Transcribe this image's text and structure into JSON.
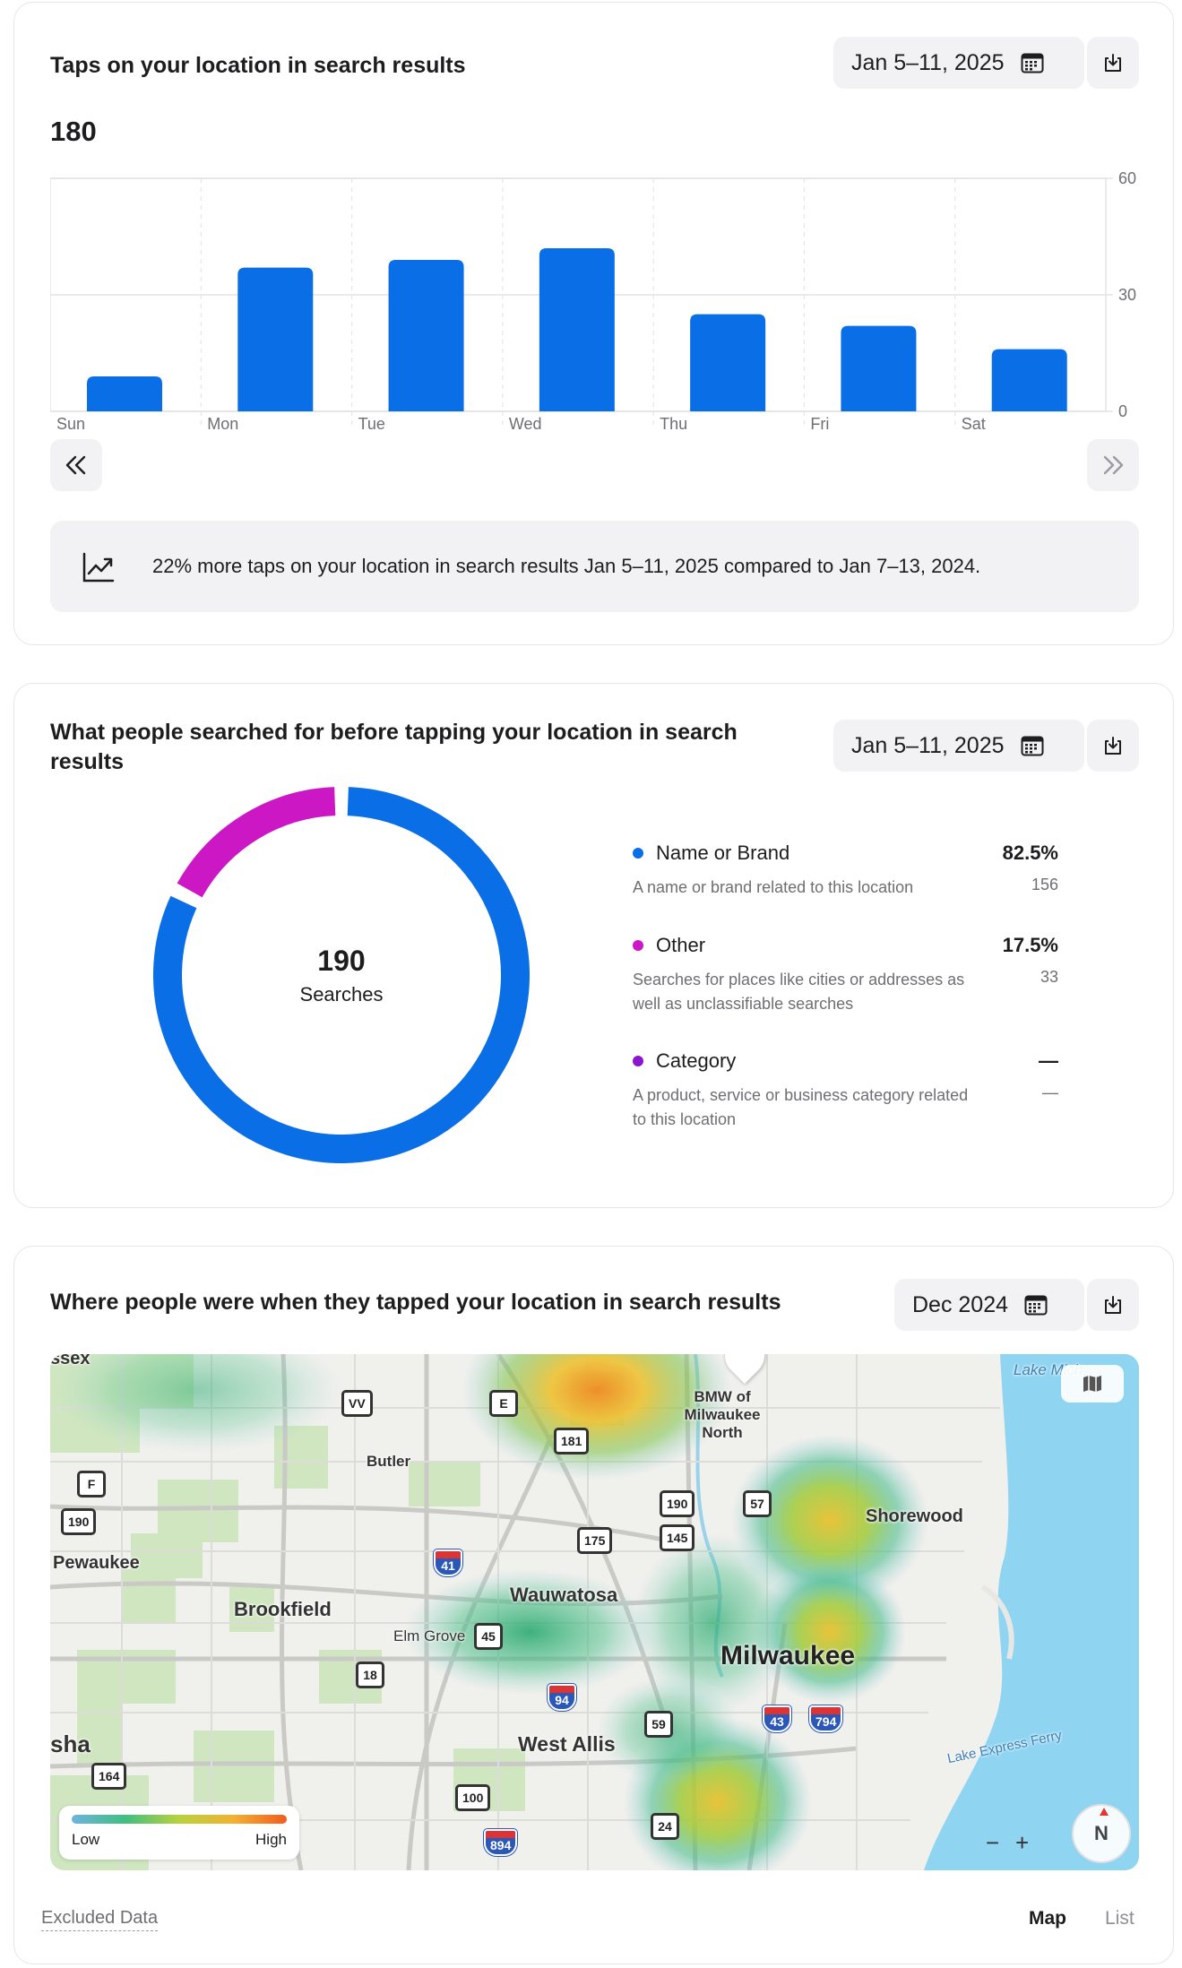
{
  "taps_card": {
    "title": "Taps on your location in search results",
    "date_range": "Jan 5–11, 2025",
    "total": "180",
    "insight": "22% more taps on your location in search results Jan 5–11, 2025 compared to Jan 7–13, 2024."
  },
  "chart_data": {
    "type": "bar",
    "categories": [
      "Sun",
      "Mon",
      "Tue",
      "Wed",
      "Thu",
      "Fri",
      "Sat"
    ],
    "values": [
      9,
      37,
      39,
      42,
      25,
      22,
      16
    ],
    "ylim": [
      0,
      60
    ],
    "yticks": [
      0,
      30,
      60
    ],
    "y_axis_side": "right",
    "grid": true,
    "color": "#0a6ee6"
  },
  "search_card": {
    "title": "What people searched for before tapping your location in search results",
    "date_range": "Jan 5–11, 2025",
    "total": "190",
    "total_label": "Searches",
    "breakdown": [
      {
        "name": "Name or Brand",
        "percent": "82.5%",
        "description": "A name or brand related to this location",
        "count": "156",
        "value": 82.5,
        "color": "#0a6ee6"
      },
      {
        "name": "Other",
        "percent": "17.5%",
        "description": "Searches for places like cities or addresses as well as unclassifiable searches",
        "count": "33",
        "value": 17.5,
        "color": "#cc18c4"
      },
      {
        "name": "Category",
        "percent": "—",
        "description": "A product, service or business category related to this location",
        "count": "—",
        "value": 0,
        "color": "#8a16cf"
      }
    ]
  },
  "map_card": {
    "title": "Where people were when they tapped your location in search results",
    "date_range": "Dec 2024",
    "legend_low": "Low",
    "legend_high": "High",
    "compass": "N",
    "zoom_out": "−",
    "zoom_in": "+",
    "excluded_link": "Excluded Data",
    "tab_map": "Map",
    "tab_list": "List",
    "places": {
      "sussex": "ssex",
      "lake_michigan": "Lake Mich",
      "bmw": "BMW of Milwaukee North",
      "butler": "Butler",
      "shorewood": "Shorewood",
      "pewaukee": "Pewaukee",
      "brookfield": "Brookfield",
      "wauwatosa": "Wauwatosa",
      "elm_grove": "Elm Grove",
      "milwaukee": "Milwaukee",
      "west_allis": "West Allis",
      "waukesha": "sha",
      "ferry": "Lake Express Ferry"
    },
    "routes": [
      "VV",
      "E",
      "181",
      "F",
      "190",
      "175",
      "190",
      "57",
      "145",
      "41",
      "45",
      "18",
      "94",
      "59",
      "43",
      "794",
      "164",
      "100",
      "24",
      "894"
    ]
  }
}
